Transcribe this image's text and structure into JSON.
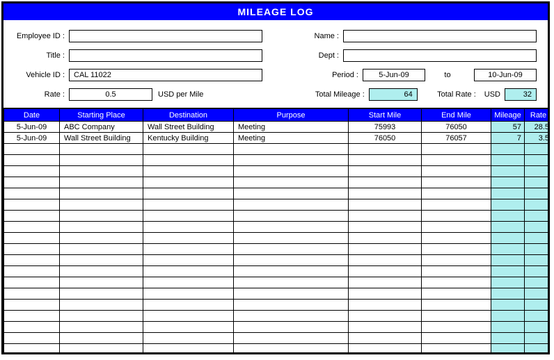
{
  "title": "MILEAGE LOG",
  "form": {
    "labels": {
      "employee_id": "Employee ID :",
      "name": "Name :",
      "title": "Title :",
      "dept": "Dept :",
      "vehicle_id": "Vehicle ID :",
      "period": "Period :",
      "to": "to",
      "rate": "Rate :",
      "rate_unit": "USD per Mile",
      "total_mileage": "Total Mileage :",
      "total_rate": "Total Rate :",
      "total_rate_unit": "USD"
    },
    "values": {
      "employee_id": "",
      "name": "",
      "title": "",
      "dept": "",
      "vehicle_id": "CAL 11022",
      "period_from": "5-Jun-09",
      "period_to": "10-Jun-09",
      "rate": "0.5",
      "total_mileage": "64",
      "total_rate": "32"
    }
  },
  "columns": [
    "Date",
    "Starting Place",
    "Destination",
    "Purpose",
    "Start Mile",
    "End Mile",
    "Mileage",
    "Rate"
  ],
  "rows": [
    {
      "date": "5-Jun-09",
      "start": "ABC Company",
      "dest": "Wall Street Building",
      "purp": "Meeting",
      "smile": "75993",
      "emile": "76050",
      "mile": "57",
      "rate": "28.5"
    },
    {
      "date": "5-Jun-09",
      "start": "Wall Street Building",
      "dest": "Kentucky Building",
      "purp": "Meeting",
      "smile": "76050",
      "emile": "76057",
      "mile": "7",
      "rate": "3.5"
    }
  ],
  "blank_rows": 19,
  "chart_data": {
    "type": "table",
    "title": "MILEAGE LOG",
    "columns": [
      "Date",
      "Starting Place",
      "Destination",
      "Purpose",
      "Start Mile",
      "End Mile",
      "Mileage",
      "Rate"
    ],
    "rows": [
      [
        "5-Jun-09",
        "ABC Company",
        "Wall Street Building",
        "Meeting",
        75993,
        76050,
        57,
        28.5
      ],
      [
        "5-Jun-09",
        "Wall Street Building",
        "Kentucky Building",
        "Meeting",
        76050,
        76057,
        7,
        3.5
      ]
    ],
    "totals": {
      "mileage": 64,
      "rate": 32
    },
    "rate_per_mile": 0.5,
    "currency": "USD",
    "period": {
      "from": "5-Jun-09",
      "to": "10-Jun-09"
    }
  }
}
